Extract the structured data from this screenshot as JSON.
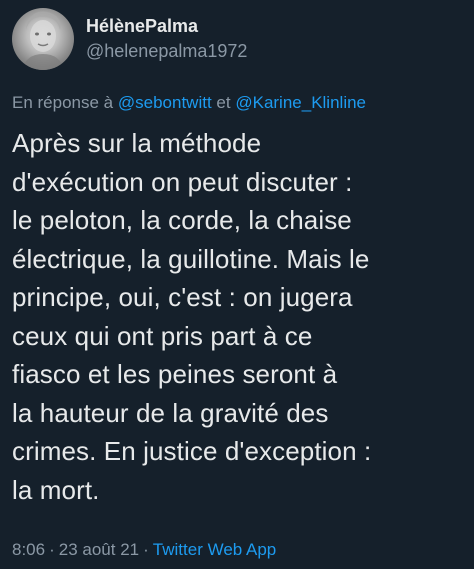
{
  "author": {
    "display_name": "HélènePalma",
    "handle": "@helenepalma1972"
  },
  "reply": {
    "prefix": "En réponse à",
    "mention_1": "@sebontwitt",
    "conjunction": "et",
    "mention_2": "@Karine_Klinline"
  },
  "tweet": {
    "lines": [
      "Après sur la méthode",
      "d'exécution on peut discuter :",
      "le peloton, la corde, la chaise",
      "électrique, la guillotine. Mais le",
      "principe, oui, c'est : on jugera",
      "ceux qui ont pris part à ce",
      "fiasco et les peines seront à",
      "la hauteur de la gravité des",
      "crimes. En justice d'exception :",
      "la mort."
    ]
  },
  "meta": {
    "time": "8:06",
    "separator": "·",
    "date": "23 août 21",
    "source": "Twitter Web App"
  },
  "colors": {
    "background": "#15202b",
    "text": "#e7e9ea",
    "secondary": "#8b98a5",
    "accent": "#1d9bf0"
  }
}
